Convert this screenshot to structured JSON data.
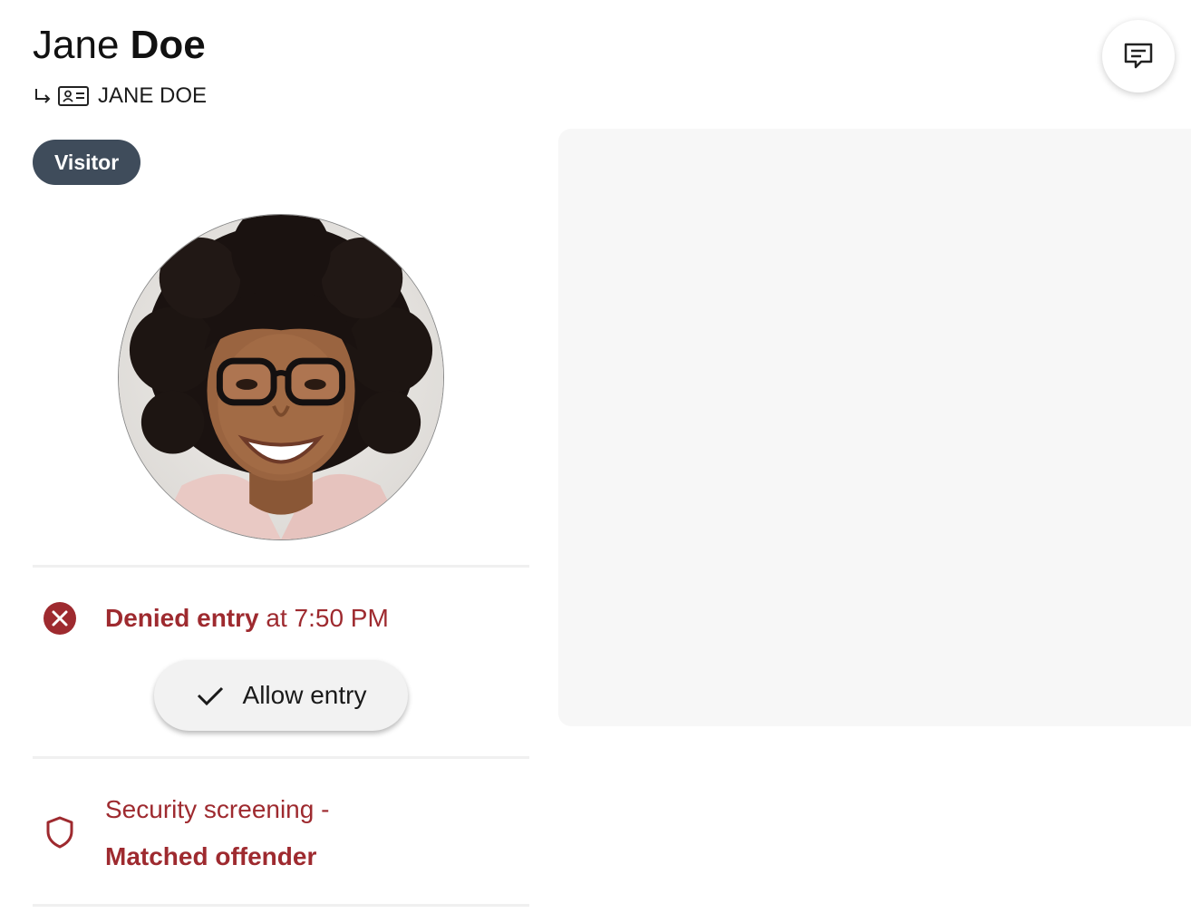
{
  "person": {
    "first_name": "Jane",
    "last_name": "Doe",
    "id_name": "JANE DOE",
    "role_badge": "Visitor"
  },
  "icons": {
    "id_arrow": "return-arrow-icon",
    "id_card": "id-card-icon",
    "denied": "x-circle-icon",
    "allow": "checkmark-icon",
    "security": "shield-icon",
    "chat": "chat-message-icon"
  },
  "entry_status": {
    "status": "Denied entry",
    "time_text": "at 7:50 PM",
    "action_label": "Allow entry"
  },
  "security_screening": {
    "label": "Security screening -",
    "result": "Matched offender"
  },
  "colors": {
    "badge_bg": "#3f4c5b",
    "alert_red": "#9e2a2f",
    "panel_bg": "#f7f7f7",
    "button_bg": "#f2f2f2"
  }
}
